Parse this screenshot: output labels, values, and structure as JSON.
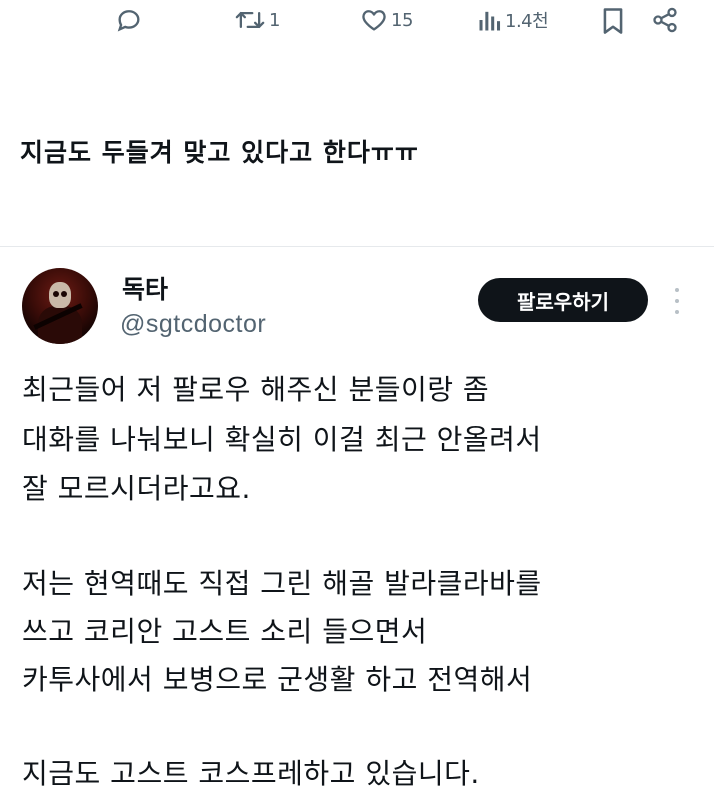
{
  "actions": {
    "comment_count": "",
    "retweet_count": "1",
    "like_count": "15",
    "view_count": "1.4천"
  },
  "previous_tweet": {
    "text": "지금도 두들겨 맞고 있다고 한다ㅠㅠ"
  },
  "tweet": {
    "author_name": "독타",
    "author_handle": "@sgtcdoctor",
    "follow_label": "팔로우하기",
    "lines": [
      "최근들어 저 팔로우 해주신 분들이랑 좀",
      "대화를 나눠보니 확실히 이걸 최근 안올려서",
      "잘 모르시더라고요.",
      "",
      "저는 현역때도 직접 그린 해골 발라클라바를",
      "쓰고 코리안 고스트 소리 들으면서",
      "카투사에서 보병으로 군생활 하고 전역해서",
      "",
      "지금도 고스트 코스프레하고 있습니다."
    ]
  },
  "icons": {
    "comment": "speech-bubble-icon",
    "retweet": "retweet-arrows-icon",
    "like": "heart-icon",
    "views": "bar-chart-icon",
    "bookmark": "bookmark-icon",
    "share": "share-nodes-icon"
  }
}
